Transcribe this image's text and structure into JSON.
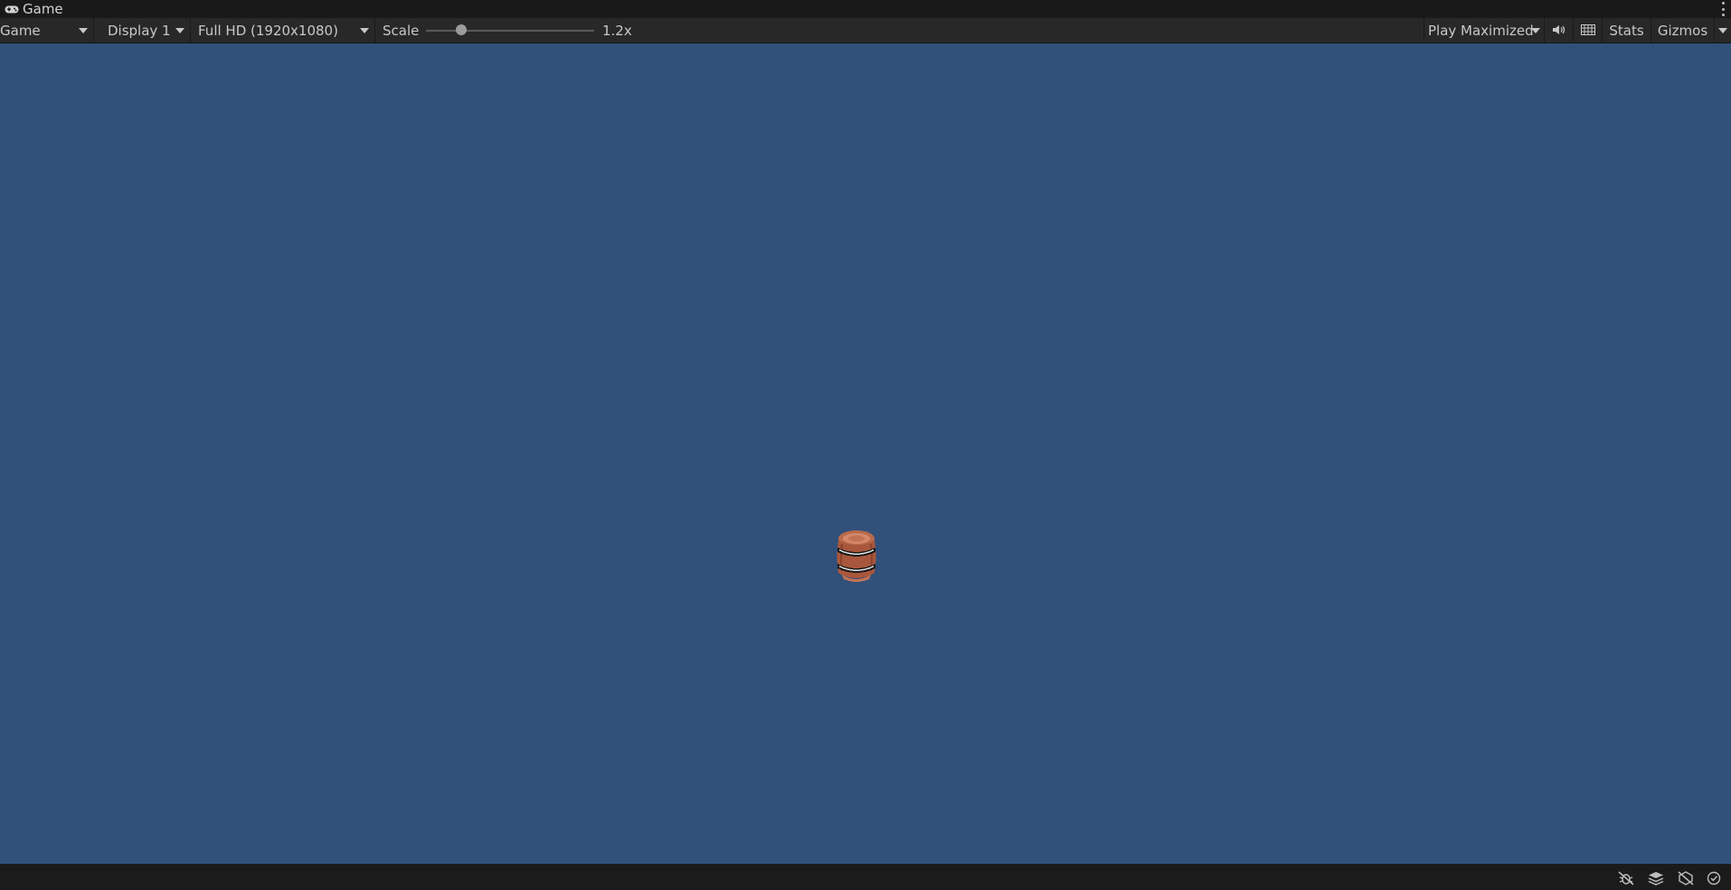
{
  "window": {
    "tab_title": "Game",
    "tab_icon": "gamepad-icon",
    "menu_icon": "kebab-menu-icon"
  },
  "toolbar": {
    "view_mode": "Game",
    "display": "Display 1",
    "resolution": "Full HD (1920x1080)",
    "scale_label": "Scale",
    "scale_value": "1.2x",
    "scale_slider_fraction": 0.21,
    "play_mode": "Play Maximized",
    "audio_icon": "speaker-icon",
    "aspect_icon": "grid-icon",
    "stats_label": "Stats",
    "gizmos_label": "Gizmos"
  },
  "viewport": {
    "background": "#31507a",
    "sprite": "barrel"
  },
  "statusbar": {
    "icons": [
      "bug-off-icon",
      "layers-icon",
      "scene-visibility-icon",
      "check-circle-icon"
    ]
  },
  "colors": {
    "titlebar": "#191919",
    "toolbar": "#282828",
    "statusbar": "#1b1b1b",
    "text": "#c8c8c8"
  }
}
